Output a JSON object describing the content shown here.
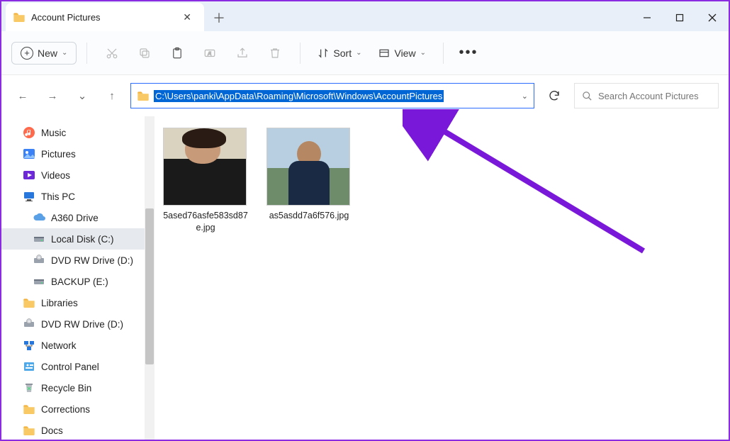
{
  "window": {
    "tab_title": "Account Pictures",
    "new_button": "New"
  },
  "toolbar": {
    "sort_label": "Sort",
    "view_label": "View"
  },
  "address": {
    "path": "C:\\Users\\panki\\AppData\\Roaming\\Microsoft\\Windows\\AccountPictures"
  },
  "search": {
    "placeholder": "Search Account Pictures"
  },
  "sidebar": {
    "items": [
      {
        "label": "Music",
        "icon": "music"
      },
      {
        "label": "Pictures",
        "icon": "pictures"
      },
      {
        "label": "Videos",
        "icon": "videos"
      },
      {
        "label": "This PC",
        "icon": "thispc"
      },
      {
        "label": "A360 Drive",
        "icon": "cloud",
        "child": true
      },
      {
        "label": "Local Disk (C:)",
        "icon": "disk",
        "child": true,
        "selected": true
      },
      {
        "label": "DVD RW Drive (D:)",
        "icon": "dvd",
        "child": true
      },
      {
        "label": "BACKUP (E:)",
        "icon": "disk",
        "child": true
      },
      {
        "label": "Libraries",
        "icon": "folder"
      },
      {
        "label": "DVD RW Drive (D:)",
        "icon": "dvd"
      },
      {
        "label": "Network",
        "icon": "network"
      },
      {
        "label": "Control Panel",
        "icon": "control"
      },
      {
        "label": "Recycle Bin",
        "icon": "recycle"
      },
      {
        "label": "Corrections",
        "icon": "folder"
      },
      {
        "label": "Docs",
        "icon": "folder"
      }
    ]
  },
  "files": [
    {
      "name": "5ased76asfe583sd87e.jpg"
    },
    {
      "name": "as5asdd7a6f576.jpg"
    }
  ]
}
